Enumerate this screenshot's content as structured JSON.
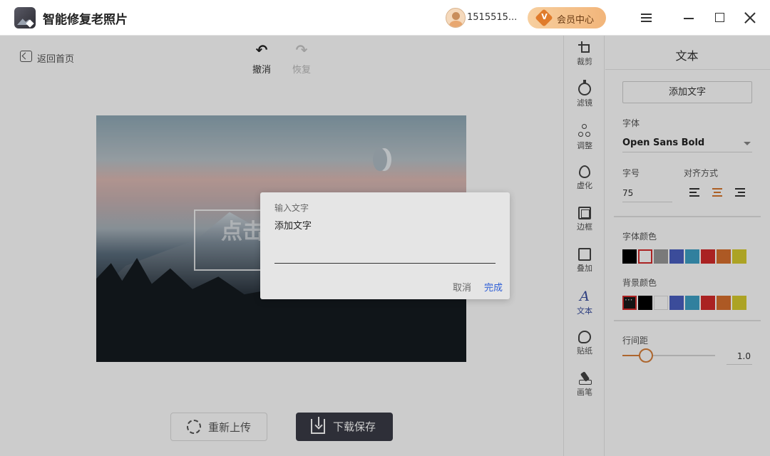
{
  "app": {
    "title": "智能修复老照片"
  },
  "header": {
    "user_name": "1515515...",
    "vip_label": "会员中心",
    "vip_badge": "V"
  },
  "main": {
    "home_label": "返回首页",
    "undo_label": "撤消",
    "redo_label": "恢复",
    "canvas_text": "点击",
    "reupload_label": "重新上传",
    "download_label": "下载保存"
  },
  "toolstrip": [
    {
      "label": "裁剪",
      "icon": "crop-icon"
    },
    {
      "label": "滤镜",
      "icon": "filter-icon"
    },
    {
      "label": "调整",
      "icon": "adjust-icon"
    },
    {
      "label": "虚化",
      "icon": "blur-icon"
    },
    {
      "label": "边框",
      "icon": "border-icon"
    },
    {
      "label": "叠加",
      "icon": "overlay-icon"
    },
    {
      "label": "文本",
      "icon": "text-icon",
      "glyph": "A",
      "active": true
    },
    {
      "label": "贴纸",
      "icon": "sticker-icon"
    },
    {
      "label": "画笔",
      "icon": "brush-icon"
    }
  ],
  "panel": {
    "title": "文本",
    "add_text_label": "添加文字",
    "font_label": "字体",
    "font_value": "Open Sans Bold",
    "size_label": "字号",
    "size_value": "75",
    "align_label": "对齐方式",
    "align_selected": "center",
    "font_color_label": "字体颜色",
    "font_colors": [
      "#000000",
      "#ffffff",
      "#999999",
      "#4a5fc1",
      "#3ea0c6",
      "#d52b2b",
      "#d9702e",
      "#d8cc2d"
    ],
    "font_color_selected": 1,
    "bg_color_label": "背景颜色",
    "bg_colors": [
      "#1a1a1a",
      "#000000",
      "#ffffff",
      "#4a5fc1",
      "#3ea0c6",
      "#d52b2b",
      "#d9702e",
      "#d8cc2d"
    ],
    "bg_color_selected": 0,
    "spacing_label": "行间距",
    "spacing_value": "1.0",
    "spacing_fraction": 0.25
  },
  "dialog": {
    "label": "输入文字",
    "input_value": "添加文字",
    "cancel_label": "取消",
    "ok_label": "完成"
  }
}
